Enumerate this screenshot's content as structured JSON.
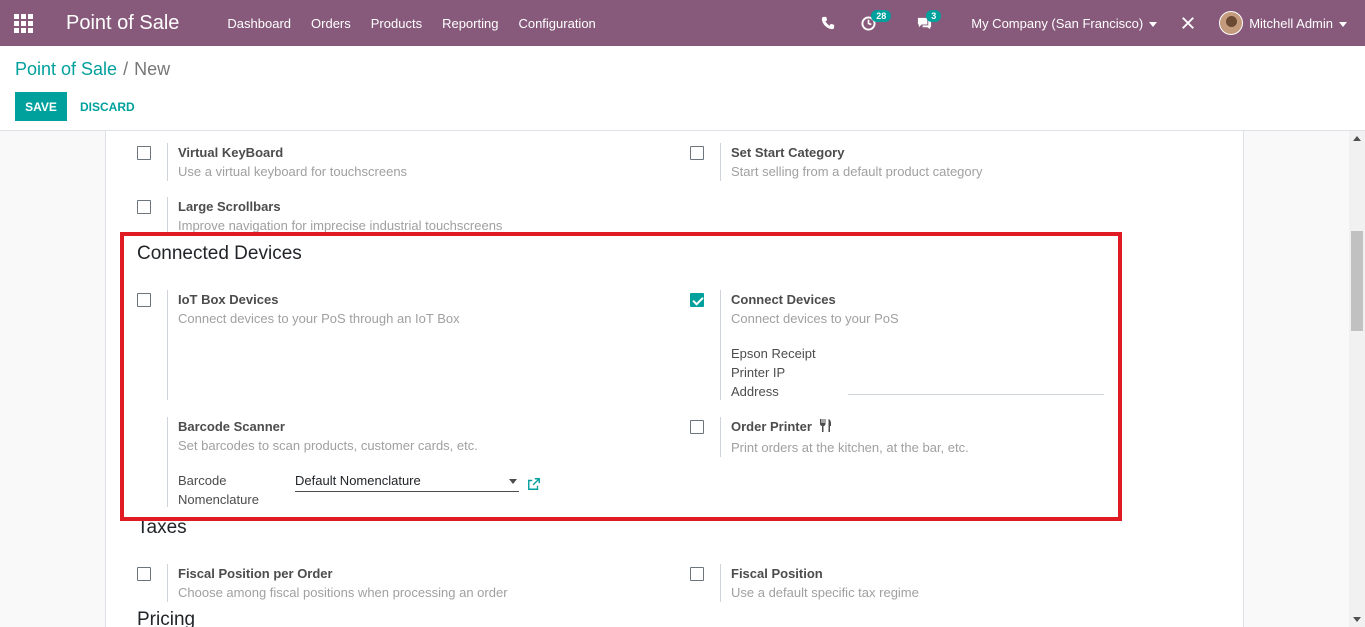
{
  "navbar": {
    "app_title": "Point of Sale",
    "menu": [
      "Dashboard",
      "Orders",
      "Products",
      "Reporting",
      "Configuration"
    ],
    "activity_count": "28",
    "message_count": "3",
    "company": "My Company (San Francisco)",
    "user": "Mitchell Admin"
  },
  "breadcrumb": {
    "parent": "Point of Sale",
    "separator": "/",
    "current": "New"
  },
  "actions": {
    "save": "SAVE",
    "discard": "DISCARD"
  },
  "settings": {
    "virtual_keyboard": {
      "title": "Virtual KeyBoard",
      "desc": "Use a virtual keyboard for touchscreens",
      "checked": false
    },
    "start_category": {
      "title": "Set Start Category",
      "desc": "Start selling from a default product category",
      "checked": false
    },
    "large_scrollbars": {
      "title": "Large Scrollbars",
      "desc": "Improve navigation for imprecise industrial touchscreens",
      "checked": false
    }
  },
  "connected_devices": {
    "section_title": "Connected Devices",
    "iot_box": {
      "title": "IoT Box Devices",
      "desc": "Connect devices to your PoS through an IoT Box",
      "checked": false
    },
    "connect_devices": {
      "title": "Connect Devices",
      "desc": "Connect devices to your PoS",
      "checked": true
    },
    "epson_label_1": "Epson Receipt",
    "epson_label_2": "Printer IP",
    "epson_label_3": "Address",
    "epson_value": "",
    "barcode_scanner": {
      "title": "Barcode Scanner",
      "desc": "Set barcodes to scan products, customer cards, etc."
    },
    "nomenclature_label_1": "Barcode",
    "nomenclature_label_2": "Nomenclature",
    "nomenclature_value": "Default Nomenclature",
    "order_printer": {
      "title": "Order Printer",
      "desc": "Print orders at the kitchen, at the bar, etc.",
      "checked": false
    }
  },
  "taxes": {
    "section_title": "Taxes",
    "fiscal_position_per_order": {
      "title": "Fiscal Position per Order",
      "desc": "Choose among fiscal positions when processing an order",
      "checked": false
    },
    "fiscal_position": {
      "title": "Fiscal Position",
      "desc": "Use a default specific tax regime",
      "checked": false
    }
  },
  "pricing": {
    "section_title": "Pricing"
  },
  "colors": {
    "navbar": "#875a7b",
    "accent": "#00a09d",
    "highlight": "#e01b24"
  }
}
